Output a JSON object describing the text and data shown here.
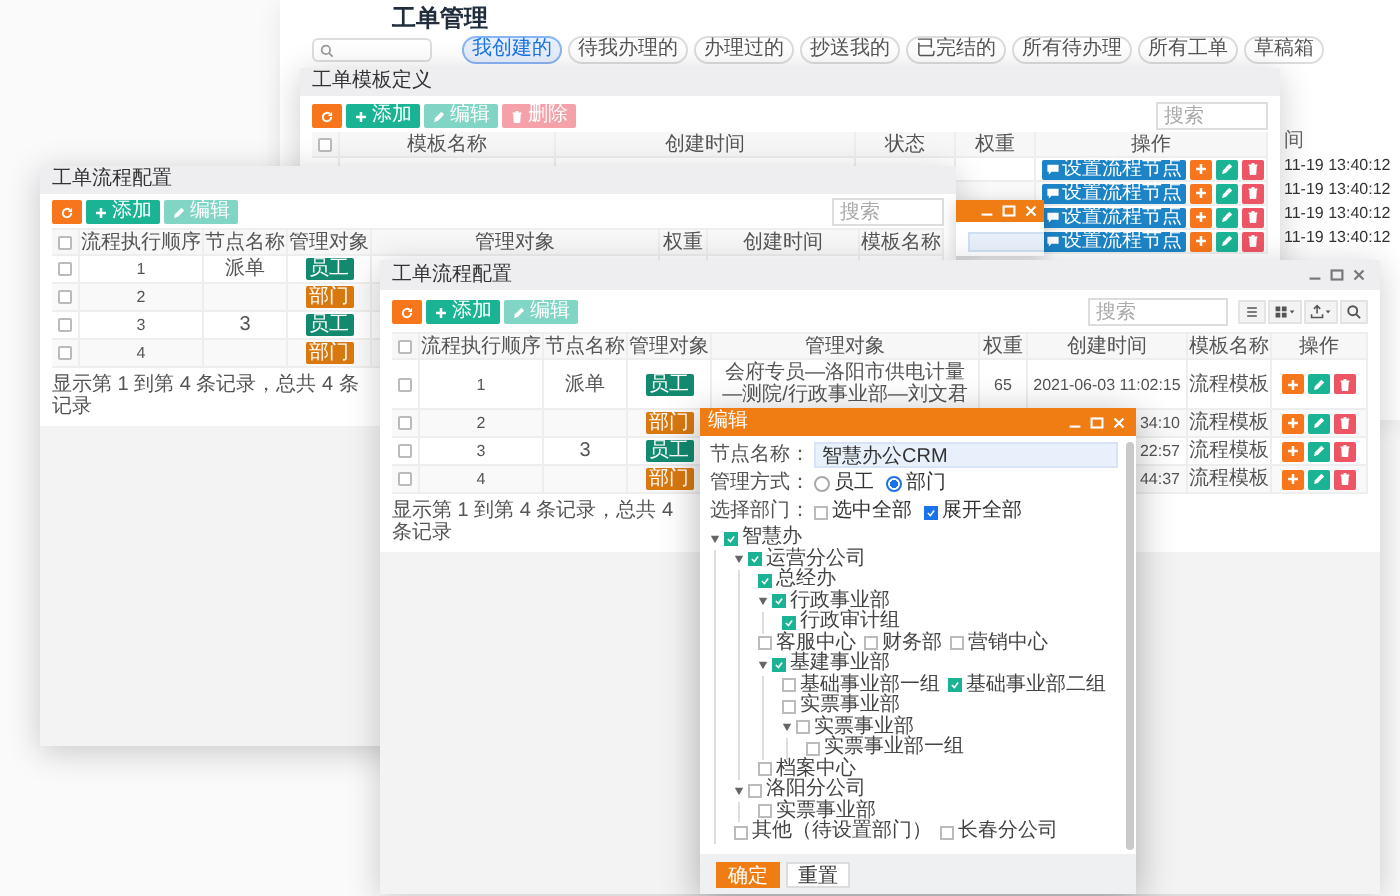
{
  "main_page": {
    "title": "工单管理",
    "tabs": [
      {
        "label": "我创建的",
        "selected": true
      },
      {
        "label": "待我办理的",
        "selected": false
      },
      {
        "label": "办理过的",
        "selected": false
      },
      {
        "label": "抄送我的",
        "selected": false
      },
      {
        "label": "已完结的",
        "selected": false
      },
      {
        "label": "所有待办理",
        "selected": false
      },
      {
        "label": "所有工单",
        "selected": false
      },
      {
        "label": "草稿箱",
        "selected": false
      }
    ],
    "column_fragment": "间",
    "time_fragments": [
      "11-19 13:40:12",
      "11-19 13:40:12",
      "11-19 13:40:12",
      "11-19 13:40:12"
    ]
  },
  "template_window": {
    "title": "工单模板定义",
    "toolbar": [
      {
        "kind": "refresh"
      },
      {
        "kind": "add",
        "label": "添加",
        "disabled": false
      },
      {
        "kind": "edit",
        "label": "编辑",
        "disabled": true
      },
      {
        "kind": "delete",
        "label": "删除",
        "disabled": true
      }
    ],
    "search": {
      "placeholder": "搜索"
    },
    "select_all": {
      "checked": false
    },
    "columns": [
      "模板名称",
      "创建时间",
      "状态",
      "权重",
      "操作"
    ],
    "rows": [
      {
        "action": "设置流程节点"
      },
      {
        "action": "设置流程节点"
      },
      {
        "action": "设置流程节点"
      },
      {
        "action": "设置流程节点"
      }
    ]
  },
  "flow_window_back": {
    "title": "工单流程配置",
    "toolbar": [
      {
        "kind": "refresh"
      },
      {
        "kind": "add",
        "label": "添加",
        "disabled": false
      },
      {
        "kind": "edit",
        "label": "编辑",
        "disabled": true
      }
    ],
    "search": {
      "placeholder": "搜索"
    },
    "select_all": {
      "checked": false
    },
    "columns": [
      "流程执行顺序",
      "节点名称",
      "管理对象",
      "管理对象",
      "权重",
      "创建时间",
      "模板名称"
    ],
    "rows": [
      {
        "checked": false,
        "order": "1",
        "node": "派单",
        "target": {
          "label": "员工",
          "color": "#138a70"
        }
      },
      {
        "checked": false,
        "order": "2",
        "target": {
          "label": "部门",
          "color": "#d9780f"
        }
      },
      {
        "checked": false,
        "order": "3",
        "node": "3",
        "target": {
          "label": "员工",
          "color": "#138a70"
        }
      },
      {
        "checked": false,
        "order": "4",
        "target": {
          "label": "部门",
          "color": "#d9780f"
        }
      }
    ],
    "footer": "显示第 1 到第 4 条记录，总共 4 条记录"
  },
  "flow_window": {
    "title": "工单流程配置",
    "toolbar": [
      {
        "kind": "refresh"
      },
      {
        "kind": "add",
        "label": "添加",
        "disabled": false
      },
      {
        "kind": "edit",
        "label": "编辑",
        "disabled": true
      }
    ],
    "search": {
      "placeholder": "搜索"
    },
    "select_all": {
      "checked": false
    },
    "columns": [
      "流程执行顺序",
      "节点名称",
      "管理对象",
      "管理对象",
      "权重",
      "创建时间",
      "模板名称",
      "操作"
    ],
    "rows": [
      {
        "checked": false,
        "order": "1",
        "node": "派单",
        "target": {
          "label": "员工",
          "color": "#138a70"
        },
        "object": "会府专员—洛阳市供电计量—测院/行政事业部—刘文君",
        "weight": "65",
        "created": "2021-06-03 11:02:15",
        "template": "流程模板"
      },
      {
        "checked": false,
        "order": "2",
        "target": {
          "label": "部门",
          "color": "#d9780f"
        },
        "created": "34:10",
        "template": "流程模板"
      },
      {
        "checked": false,
        "order": "3",
        "node": "3",
        "target": {
          "label": "员工",
          "color": "#138a70"
        },
        "created": "22:57",
        "template": "流程模板"
      },
      {
        "checked": false,
        "order": "4",
        "target": {
          "label": "部门",
          "color": "#d9780f"
        },
        "created": "44:37",
        "template": "流程模板"
      }
    ],
    "footer": "显示第 1 到第 4 条记录，总共 4 条记录"
  },
  "dialog": {
    "title": "编辑",
    "name_field": {
      "label": "节点名称：",
      "value": "智慧办公CRM"
    },
    "mode": {
      "label": "管理方式：",
      "options": [
        {
          "label": "员工",
          "selected": false
        },
        {
          "label": "部门",
          "selected": true
        }
      ]
    },
    "departments": {
      "label": "选择部门：",
      "options": [
        {
          "label": "选中全部",
          "checked": false
        },
        {
          "label": "展开全部",
          "checked": true
        }
      ],
      "tree": [
        {
          "label": "智慧办",
          "checked": true,
          "expanded": true,
          "children": [
            {
              "label": "运营分公司",
              "checked": true,
              "expanded": true,
              "children": [
                {
                  "label": "总经办",
                  "checked": true
                },
                {
                  "label": "行政事业部",
                  "checked": true,
                  "expanded": true,
                  "children": [
                    {
                      "label": "行政审计组",
                      "checked": true
                    }
                  ]
                },
                {
                  "label": "客服中心",
                  "checked": false
                },
                {
                  "label": "财务部",
                  "checked": false
                },
                {
                  "label": "营销中心",
                  "checked": false
                },
                {
                  "label": "基建事业部",
                  "checked": true,
                  "expanded": true,
                  "children": [
                    {
                      "label": "基础事业部一组",
                      "checked": false
                    },
                    {
                      "label": "基础事业部二组",
                      "checked": true
                    },
                    {
                      "label": "实票事业部",
                      "checked": false
                    },
                    {
                      "label": "实票事业部",
                      "checked": false,
                      "expanded": true,
                      "children": [
                        {
                          "label": "实票事业部一组",
                          "checked": false
                        }
                      ]
                    }
                  ]
                },
                {
                  "label": "档案中心",
                  "checked": false
                }
              ]
            },
            {
              "label": "洛阳分公司",
              "checked": false,
              "expanded": true,
              "children": [
                {
                  "label": "实票事业部",
                  "checked": false
                }
              ]
            },
            {
              "label": "其他（待设置部门）",
              "checked": false
            },
            {
              "label": "长春分公司",
              "checked": false
            }
          ]
        }
      ]
    },
    "buttons": [
      {
        "label": "确定",
        "kind": "primary"
      },
      {
        "label": "重置",
        "kind": "default"
      }
    ]
  }
}
